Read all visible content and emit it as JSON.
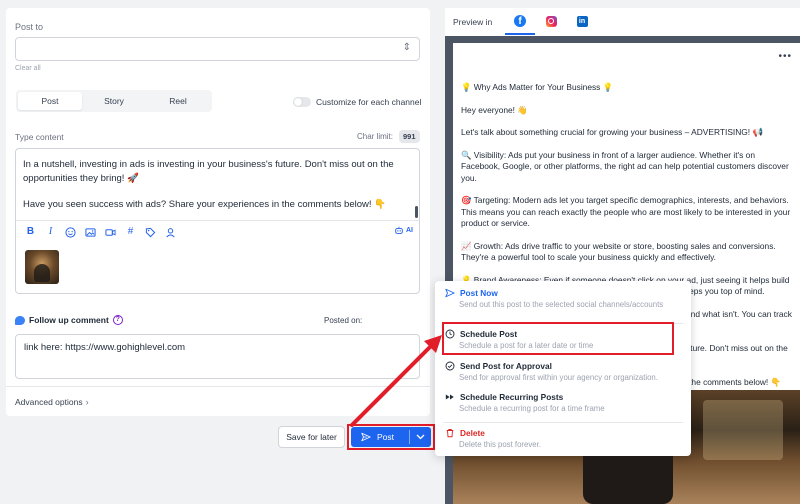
{
  "compose": {
    "post_to_label": "Post to",
    "clear_all": "Clear all",
    "tabs": [
      {
        "label": "Post",
        "active": true
      },
      {
        "label": "Story",
        "active": false
      },
      {
        "label": "Reel",
        "active": false
      }
    ],
    "customize_label": "Customize for each channel",
    "type_content_label": "Type content",
    "char_limit_label": "Char limit:",
    "char_limit_value": "991",
    "editor_paragraphs": [
      "In a nutshell, investing in ads is investing in your business's future. Don't miss out on the opportunities they bring! 🚀",
      "Have you seen success with ads? Share your experiences in the comments below! 👇"
    ],
    "toolbar_icons": [
      "bold-icon",
      "italic-icon",
      "emoji-icon",
      "image-icon",
      "video-icon",
      "hashtag-icon",
      "tag-icon",
      "mention-icon"
    ],
    "ai_label": "AI",
    "follow_up_label": "Follow up comment",
    "posted_on_label": "Posted on:",
    "comment_text": "link here: https://www.gohighlevel.com",
    "advanced_options": "Advanced options"
  },
  "actions": {
    "save_later": "Save for later",
    "post": "Post"
  },
  "preview": {
    "preview_in": "Preview in",
    "networks": [
      "facebook",
      "instagram",
      "linkedin"
    ],
    "active_network": "facebook",
    "paragraphs": [
      "💡 Why Ads Matter for Your Business 💡",
      "Hey everyone! 👋",
      "Let's talk about something crucial for growing your business – ADVERTISING! 📢",
      "🔍 Visibility: Ads put your business in front of a larger audience. Whether it's on Facebook, Google, or other platforms, the right ad can help potential customers discover you.",
      "🎯 Targeting: Modern ads let you target specific demographics, interests, and behaviors. This means you can reach exactly the people who are most likely to be interested in your product or service.",
      "📈 Growth: Ads drive traffic to your website or store, boosting sales and conversions. They're a powerful tool to scale your business quickly and effectively.",
      "💡 Brand Awareness: Even if someone doesn't click on your ad, just seeing it helps build familiarity and trust with your brand. Consistent advertising keeps you top of mind.",
      "📊 Measurable Results: With ads, you can track what works and what isn't. You can track ROI and fine-tune your strategies for the best results.",
      "In a nutshell, investing in ads is investing in your business's future. Don't miss out on the opportunities they bring! 🚀",
      "Have you seen success with ads? Share your experiences in the comments below! 👇"
    ]
  },
  "menu": {
    "items": [
      {
        "title": "Post Now",
        "desc": "Send out this post to the selected social channels/accounts"
      },
      {
        "title": "Schedule Post",
        "desc": "Schedule a post for a later date or time"
      },
      {
        "title": "Send Post for Approval",
        "desc": "Send for approval first within your agency or organization."
      },
      {
        "title": "Schedule Recurring Posts",
        "desc": "Schedule a recurring post for a time frame"
      },
      {
        "title": "Delete",
        "desc": "Delete this post forever."
      }
    ]
  },
  "colors": {
    "primary": "#1d64ef",
    "annotation": "#e11d2a",
    "danger": "#dc2626"
  }
}
